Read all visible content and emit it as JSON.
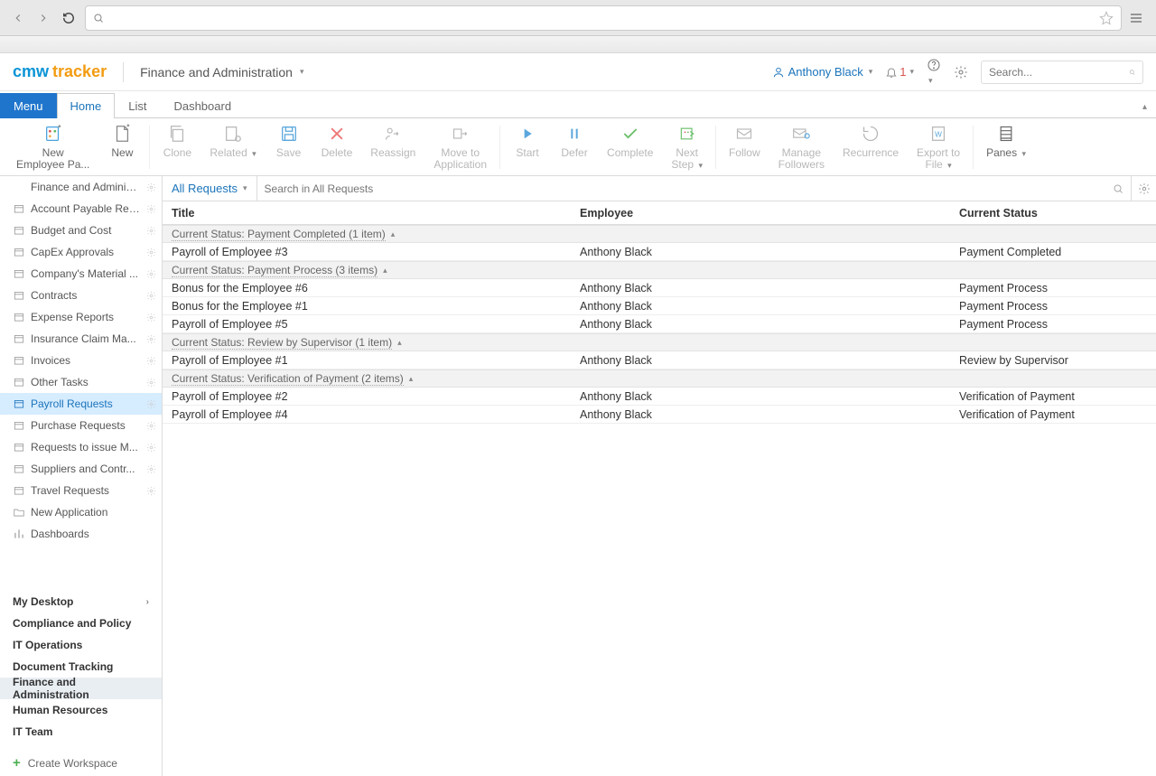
{
  "browser": {
    "addr_placeholder": ""
  },
  "logo": {
    "cmw": "cmw",
    "tracker": "tracker"
  },
  "breadcrumb": "Finance and Administration",
  "user": {
    "name": "Anthony Black"
  },
  "notifications": {
    "count": "1"
  },
  "search_placeholder": "Search...",
  "tabs": {
    "menu": "Menu",
    "home": "Home",
    "list": "List",
    "dashboard": "Dashboard"
  },
  "ribbon": [
    {
      "key": "new-emp",
      "label": "New\nEmployee Pa...",
      "disabled": false
    },
    {
      "key": "new",
      "label": "New",
      "disabled": false
    },
    {
      "key": "clone",
      "label": "Clone",
      "disabled": true
    },
    {
      "key": "related",
      "label": "Related",
      "disabled": true
    },
    {
      "key": "save",
      "label": "Save",
      "disabled": true
    },
    {
      "key": "delete",
      "label": "Delete",
      "disabled": true
    },
    {
      "key": "reassign",
      "label": "Reassign",
      "disabled": true
    },
    {
      "key": "moveto",
      "label": "Move to\nApplication",
      "disabled": true
    },
    {
      "key": "start",
      "label": "Start",
      "disabled": true
    },
    {
      "key": "defer",
      "label": "Defer",
      "disabled": true
    },
    {
      "key": "complete",
      "label": "Complete",
      "disabled": true
    },
    {
      "key": "next",
      "label": "Next\nStep",
      "disabled": true
    },
    {
      "key": "follow",
      "label": "Follow",
      "disabled": true
    },
    {
      "key": "managefollowers",
      "label": "Manage\nFollowers",
      "disabled": true
    },
    {
      "key": "recurrence",
      "label": "Recurrence",
      "disabled": true
    },
    {
      "key": "export",
      "label": "Export to\nFile",
      "disabled": true
    },
    {
      "key": "panes",
      "label": "Panes",
      "disabled": false
    }
  ],
  "sidebar": [
    {
      "label": "Finance and Administrati...",
      "gear": true,
      "ico": "none"
    },
    {
      "label": "Account Payable Req...",
      "gear": true,
      "ico": "box"
    },
    {
      "label": "Budget and Cost",
      "gear": true,
      "ico": "box"
    },
    {
      "label": "CapEx Approvals",
      "gear": true,
      "ico": "box"
    },
    {
      "label": "Company's Material ...",
      "gear": true,
      "ico": "box"
    },
    {
      "label": "Contracts",
      "gear": true,
      "ico": "box"
    },
    {
      "label": "Expense Reports",
      "gear": true,
      "ico": "box"
    },
    {
      "label": "Insurance Claim Ma...",
      "gear": true,
      "ico": "box"
    },
    {
      "label": "Invoices",
      "gear": true,
      "ico": "box"
    },
    {
      "label": "Other Tasks",
      "gear": true,
      "ico": "box"
    },
    {
      "label": "Payroll Requests",
      "gear": true,
      "ico": "box",
      "active": true
    },
    {
      "label": "Purchase Requests",
      "gear": true,
      "ico": "box"
    },
    {
      "label": "Requests to issue M...",
      "gear": true,
      "ico": "box"
    },
    {
      "label": "Suppliers and Contr...",
      "gear": true,
      "ico": "box"
    },
    {
      "label": "Travel Requests",
      "gear": true,
      "ico": "box"
    },
    {
      "label": "New Application",
      "gear": false,
      "ico": "folder"
    },
    {
      "label": "Dashboards",
      "gear": false,
      "ico": "bars"
    }
  ],
  "workspaces": [
    {
      "label": "My Desktop",
      "caret": true
    },
    {
      "label": "Compliance and Policy"
    },
    {
      "label": "IT Operations"
    },
    {
      "label": "Document Tracking"
    },
    {
      "label": "Finance and Administration",
      "active": true
    },
    {
      "label": "Human Resources"
    },
    {
      "label": "IT Team"
    }
  ],
  "create_workspace": "Create Workspace",
  "view": {
    "name": "All Requests",
    "search_prefix": "Search in ",
    "search_target": "All Requests"
  },
  "columns": {
    "title": "Title",
    "employee": "Employee",
    "status": "Current Status"
  },
  "groups": [
    {
      "header": "Current Status: Payment Completed (1 item)",
      "rows": [
        {
          "title": "Payroll of Employee #3",
          "employee": "Anthony Black",
          "status": "Payment Completed"
        }
      ]
    },
    {
      "header": "Current Status: Payment Process (3 items)",
      "rows": [
        {
          "title": "Bonus for the Employee #6",
          "employee": "Anthony Black",
          "status": "Payment Process"
        },
        {
          "title": "Bonus for the Employee #1",
          "employee": "Anthony Black",
          "status": "Payment Process"
        },
        {
          "title": "Payroll of Employee #5",
          "employee": "Anthony Black",
          "status": "Payment Process"
        }
      ]
    },
    {
      "header": "Current Status: Review by Supervisor (1 item)",
      "rows": [
        {
          "title": "Payroll of Employee #1",
          "employee": "Anthony Black",
          "status": "Review by Supervisor"
        }
      ]
    },
    {
      "header": "Current Status: Verification of Payment (2 items)",
      "rows": [
        {
          "title": "Payroll of Employee #2",
          "employee": "Anthony Black",
          "status": "Verification of Payment"
        },
        {
          "title": "Payroll of Employee #4",
          "employee": "Anthony Black",
          "status": "Verification of Payment"
        }
      ]
    }
  ]
}
